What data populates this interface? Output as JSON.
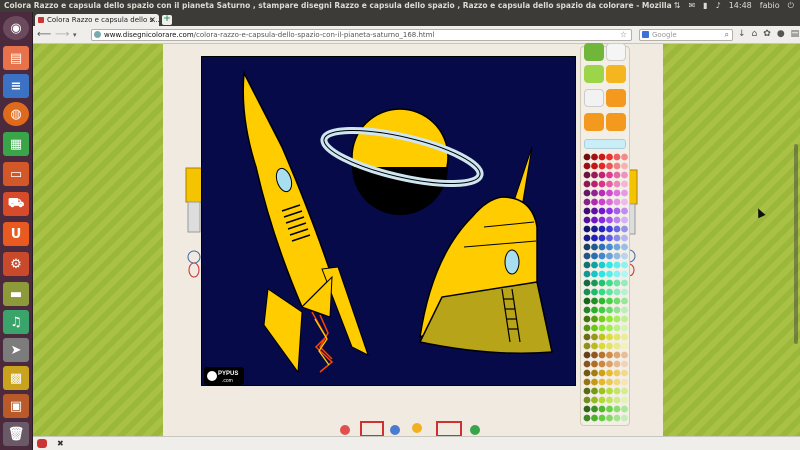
{
  "window": {
    "title": "Colora Razzo e capsula dello spazio con il pianeta Saturno , stampare disegni Razzo e capsula dello spazio , Razzo e capsula dello spazio da colorare - Mozilla Firefox"
  },
  "system_tray": {
    "time": "14:48",
    "user": "fabio"
  },
  "browser": {
    "tab_label": "Colora Razzo e capsula dello s...",
    "new_tab_label": "+",
    "url_domain": "www.disegnicolorare.com",
    "url_path": "/colora-razzo-e-capsula-dello-spazio-con-il-pianeta-saturno_168.html",
    "search_placeholder": "Google"
  },
  "canvas": {
    "watermark": "PYPUS",
    "watermark_sub": ".com"
  },
  "launcher_icons": [
    "dash-icon",
    "files-icon",
    "writer-icon",
    "firefox-icon",
    "calc-icon",
    "impress-icon",
    "software-center-icon",
    "ubuntu-one-icon",
    "settings-icon",
    "drive-icon",
    "media-icon",
    "send-icon",
    "game-icon",
    "game2-icon",
    "trash-icon"
  ],
  "colors": {
    "canvas_bg": "#070a48",
    "rocket_yellow": "#ffcc00",
    "rocket_nose": "#ff4400",
    "capsule_olive": "#b8a418",
    "planet_ring": "#cfe6f0"
  }
}
